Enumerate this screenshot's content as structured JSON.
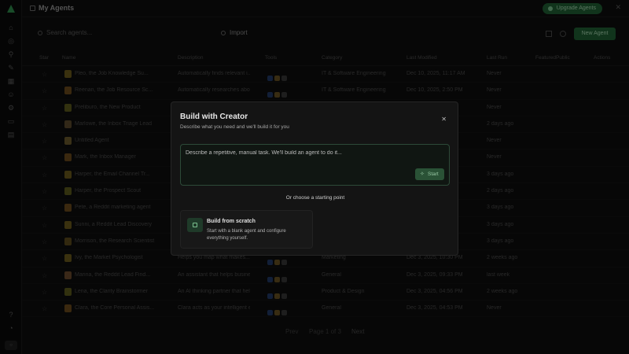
{
  "topbar": {
    "title": "My Agents",
    "upgrade_label": "Upgrade Agents"
  },
  "toolbar": {
    "search_placeholder": "Search agents...",
    "import_label": "Import",
    "new_label": "New Agent"
  },
  "table": {
    "headers": [
      "Star",
      "Name",
      "Description",
      "Tools",
      "Category",
      "Last Modified",
      "Last Run",
      "FeaturedPublic",
      "Actions"
    ],
    "rows": [
      {
        "name": "Pleo, the Job Knowledge Su...",
        "desc": "Automatically finds relevant i...",
        "category": "IT & Software Engineering",
        "modified": "Dec 10, 2025, 11:17 AM",
        "last_run": "Never",
        "featured": "",
        "color": "#6b5a1c"
      },
      {
        "name": "Reenan, the Job Resource Sc...",
        "desc": "Automatically researches abo...",
        "category": "IT & Software Engineering",
        "modified": "Dec 10, 2025, 2:50 PM",
        "last_run": "Never",
        "featured": "",
        "color": "#6b4a1c"
      },
      {
        "name": "Preliburo, the New Product",
        "desc": "",
        "category": "",
        "modified": "",
        "last_run": "Never",
        "featured": "",
        "color": "#5b5a1c"
      },
      {
        "name": "Marlowe, the Inbox Triage Lead",
        "desc": "",
        "category": "",
        "modified": "",
        "last_run": "2 days ago",
        "featured": "",
        "color": "#5b4a2c"
      },
      {
        "name": "Untitled Agent",
        "desc": "",
        "category": "",
        "modified": "",
        "last_run": "Never",
        "featured": "",
        "color": "#6b5a2c"
      },
      {
        "name": "Mark, the Inbox Manager",
        "desc": "",
        "category": "",
        "modified": "",
        "last_run": "Never",
        "featured": "",
        "color": "#6b4a1c"
      },
      {
        "name": "Harper, the Email Channel Tr...",
        "desc": "",
        "category": "",
        "modified": "",
        "last_run": "3 days ago",
        "featured": "",
        "color": "#6b5a1c"
      },
      {
        "name": "Harper, the Prospect Scout",
        "desc": "",
        "category": "",
        "modified": "",
        "last_run": "2 days ago",
        "featured": "",
        "color": "#5b5a1c"
      },
      {
        "name": "Pete, a Reddit marketing agent",
        "desc": "",
        "category": "",
        "modified": "",
        "last_run": "3 days ago",
        "featured": "",
        "color": "#6b4a1c"
      },
      {
        "name": "Sunni, a Reddit Lead Discovery",
        "desc": "",
        "category": "",
        "modified": "",
        "last_run": "3 days ago",
        "featured": "",
        "color": "#6b5a1c"
      },
      {
        "name": "Morrison, the Research Scientist",
        "desc": "",
        "category": "",
        "modified": "",
        "last_run": "3 days ago",
        "featured": "",
        "color": "#5b4a1c"
      },
      {
        "name": "Ivy, the Market Psychologist",
        "desc": "Helps you map what makes...",
        "category": "Marketing",
        "modified": "Dec 3, 2025, 10:30 PM",
        "last_run": "2 weeks ago",
        "featured": "",
        "color": "#6b5a1c"
      },
      {
        "name": "Marina, the Reddit Lead Find...",
        "desc": "An assistant that helps busines...",
        "category": "General",
        "modified": "Dec 3, 2025, 09:33 PM",
        "last_run": "last week",
        "featured": "",
        "color": "#6b4a2c"
      },
      {
        "name": "Lena, the Clarity Brainstormer",
        "desc": "An AI thinking partner that hel...",
        "category": "Product & Design",
        "modified": "Dec 3, 2025, 04:56 PM",
        "last_run": "2 weeks ago",
        "featured": "",
        "color": "#5b5a1c"
      },
      {
        "name": "Clara, the Core Personal Assis...",
        "desc": "Clara acts as your intelligent e...",
        "category": "General",
        "modified": "Dec 3, 2025, 04:53 PM",
        "last_run": "Never",
        "featured": "",
        "color": "#6b4a1c"
      }
    ]
  },
  "pager": {
    "prev": "Prev",
    "page": "Page 1 of 3",
    "next": "Next"
  },
  "modal": {
    "title": "Build with Creator",
    "subtitle": "Describe what you need and we'll build it for you",
    "prompt_placeholder": "Describe a repetitive, manual task. We'll build an agent to do it...",
    "start_label": "Start",
    "or_label": "Or choose a starting point",
    "card_title": "Build from scratch",
    "card_desc": "Start with a blank agent and configure everything yourself."
  },
  "colors": {
    "accent": "#1f5f33",
    "accent_text": "#a8d8b2"
  }
}
